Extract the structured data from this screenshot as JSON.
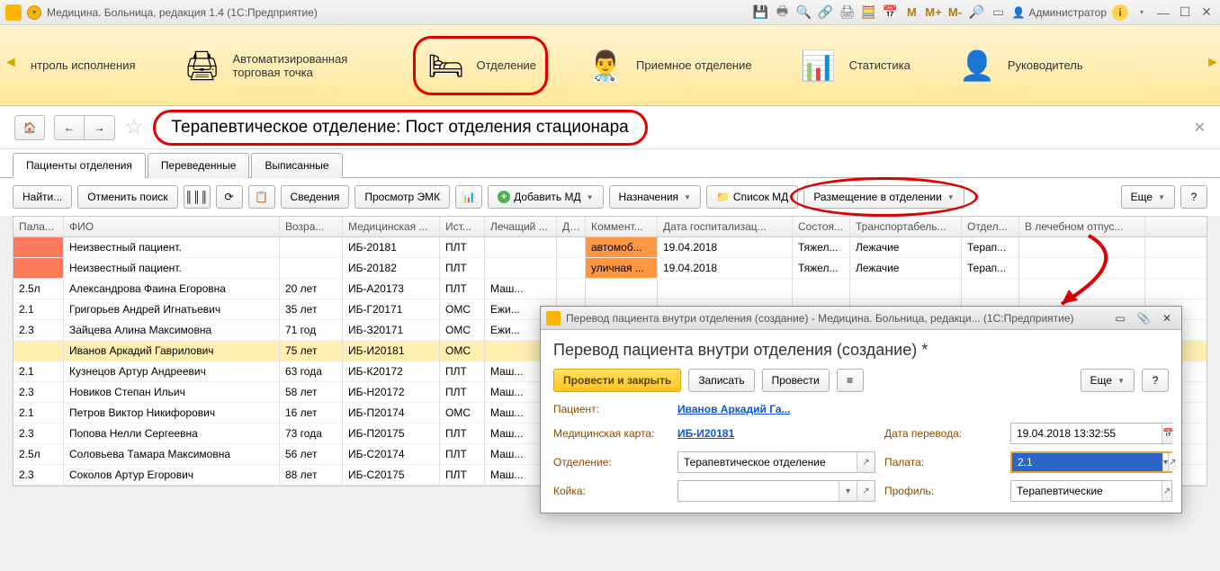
{
  "app": {
    "title": "Медицина. Больница, редакция 1.4  (1С:Предприятие)",
    "admin_label": "Администратор"
  },
  "ribbon": {
    "items": [
      {
        "label": "нтроль исполнения",
        "icon": ""
      },
      {
        "label": "Автоматизированная торговая точка",
        "icon": "🖨"
      },
      {
        "label": "Отделение",
        "icon": "🛏",
        "highlight": true
      },
      {
        "label": "Приемное отделение",
        "icon": "👨‍⚕️"
      },
      {
        "label": "Статистика",
        "icon": "📊"
      },
      {
        "label": "Руководитель",
        "icon": "👤"
      }
    ]
  },
  "page": {
    "title": "Терапевтическое отделение: Пост отделения стационара"
  },
  "tabs": [
    "Пациенты отделения",
    "Переведенные",
    "Выписанные"
  ],
  "toolbar": {
    "find": "Найти...",
    "cancel_find": "Отменить поиск",
    "info": "Сведения",
    "emk": "Просмотр ЭМК",
    "add_md": "Добавить МД",
    "assign": "Назначения",
    "list_md": "Список МД",
    "placement": "Размещение в отделении",
    "more": "Еще",
    "help": "?"
  },
  "columns": [
    "Пала...",
    "ФИО",
    "Возра...",
    "Медицинская ...",
    "Ист...",
    "Лечащий ...",
    "Ди...",
    "Коммент...",
    "Дата госпитализац...",
    "Состоя...",
    "Транспортабель...",
    "Отдел...",
    "В лечебном отпус..."
  ],
  "rows": [
    {
      "ward": "",
      "ward_red": true,
      "fio": "Неизвестный пациент.",
      "age": "",
      "card": "ИБ-20181",
      "src": "ПЛТ",
      "doc": "",
      "diag": "",
      "comm": "автомоб...",
      "comm_hl": "orange",
      "hosp": "19.04.2018",
      "state": "Тяжел...",
      "trans": "Лежачие",
      "dept": "Терап..."
    },
    {
      "ward": "",
      "ward_red": true,
      "fio": "Неизвестный пациент.",
      "age": "",
      "card": "ИБ-20182",
      "src": "ПЛТ",
      "doc": "",
      "diag": "",
      "comm": "уличная ...",
      "comm_hl": "orange",
      "hosp": "19.04.2018",
      "state": "Тяжел...",
      "trans": "Лежачие",
      "dept": "Терап..."
    },
    {
      "ward": "2.5л",
      "fio": "Александрова Фаина Егоровна",
      "age": "20 лет",
      "card": "ИБ-А20173",
      "src": "ПЛТ",
      "doc": "Маш..."
    },
    {
      "ward": "2.1",
      "fio": "Григорьев Андрей Игнатьевич",
      "age": "35 лет",
      "card": "ИБ-Г20171",
      "src": "ОМС",
      "doc": "Ежи..."
    },
    {
      "ward": "2.3",
      "fio": "Зайцева Алина Максимовна",
      "age": "71 год",
      "card": "ИБ-З20171",
      "src": "ОМС",
      "doc": "Ежи..."
    },
    {
      "ward": "",
      "fio": "Иванов Аркадий Гаврилович",
      "age": "75 лет",
      "card": "ИБ-И20181",
      "src": "ОМС",
      "doc": "",
      "sel": true
    },
    {
      "ward": "2.1",
      "fio": "Кузнецов Артур Андреевич",
      "age": "63 года",
      "card": "ИБ-К20172",
      "src": "ПЛТ",
      "doc": "Маш..."
    },
    {
      "ward": "2.3",
      "fio": "Новиков Степан Ильич",
      "age": "58 лет",
      "card": "ИБ-Н20172",
      "src": "ПЛТ",
      "doc": "Маш..."
    },
    {
      "ward": "2.1",
      "fio": "Петров Виктор Никифорович",
      "age": "16 лет",
      "card": "ИБ-П20174",
      "src": "ОМС",
      "doc": "Маш..."
    },
    {
      "ward": "2.3",
      "fio": "Попова Нелли Сергеевна",
      "age": "73 года",
      "card": "ИБ-П20175",
      "src": "ПЛТ",
      "doc": "Маш..."
    },
    {
      "ward": "2.5л",
      "fio": "Соловьева Тамара Максимовна",
      "age": "56 лет",
      "card": "ИБ-С20174",
      "src": "ПЛТ",
      "doc": "Маш..."
    },
    {
      "ward": "2.3",
      "fio": "Соколов Артур Егорович",
      "age": "88 лет",
      "card": "ИБ-С20175",
      "src": "ПЛТ",
      "doc": "Маш..."
    }
  ],
  "dialog": {
    "title": "Перевод пациента внутри отделения (создание) - Медицина. Больница, редакци...  (1С:Предприятие)",
    "heading": "Перевод пациента внутри отделения (создание) *",
    "btn_post_close": "Провести и закрыть",
    "btn_save": "Записать",
    "btn_post": "Провести",
    "btn_more": "Еще",
    "btn_help": "?",
    "labels": {
      "patient": "Пациент:",
      "card": "Медицинская карта:",
      "date": "Дата перевода:",
      "dept": "Отделение:",
      "ward": "Палата:",
      "bed": "Койка:",
      "profile": "Профиль:"
    },
    "values": {
      "patient": "Иванов Аркадий Га...",
      "card": "ИБ-И20181",
      "date": "19.04.2018 13:32:55",
      "dept": "Терапевтическое отделение",
      "ward": "2.1",
      "bed": "",
      "profile": "Терапевтические"
    }
  }
}
